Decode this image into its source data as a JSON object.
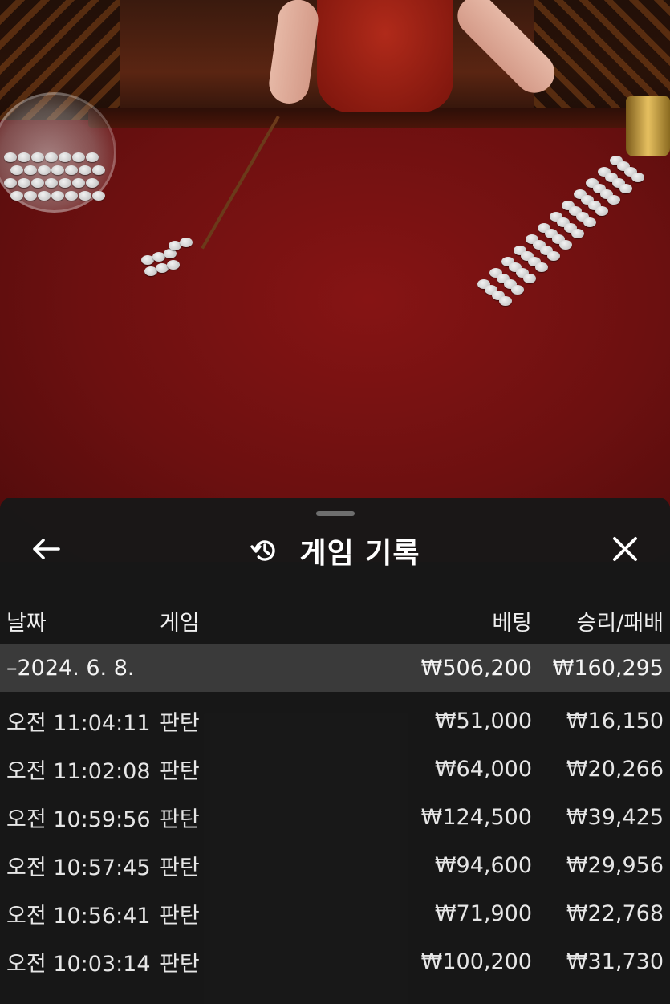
{
  "panel": {
    "title": "게임 기록",
    "back_icon": "arrow-left-icon",
    "history_icon": "history-icon",
    "close_icon": "close-icon"
  },
  "table": {
    "headers": {
      "date": "날짜",
      "game": "게임",
      "bet": "베팅",
      "result": "승리/패배"
    },
    "summary": {
      "date": "–2024. 6. 8.",
      "bet": "₩506,200",
      "result": "₩160,295"
    },
    "rows": [
      {
        "time": "오전 11:04:11",
        "game": "판탄",
        "bet": "₩51,000",
        "result": "₩16,150"
      },
      {
        "time": "오전 11:02:08",
        "game": "판탄",
        "bet": "₩64,000",
        "result": "₩20,266"
      },
      {
        "time": "오전 10:59:56",
        "game": "판탄",
        "bet": "₩124,500",
        "result": "₩39,425"
      },
      {
        "time": "오전 10:57:45",
        "game": "판탄",
        "bet": "₩94,600",
        "result": "₩29,956"
      },
      {
        "time": "오전 10:56:41",
        "game": "판탄",
        "bet": "₩71,900",
        "result": "₩22,768"
      },
      {
        "time": "오전 10:03:14",
        "game": "판탄",
        "bet": "₩100,200",
        "result": "₩31,730"
      }
    ]
  },
  "colors": {
    "sheet_bg": "#181818",
    "summary_bg": "#3a3a3a",
    "text": "#e6e6e6",
    "felt": "#6e0f0f"
  }
}
